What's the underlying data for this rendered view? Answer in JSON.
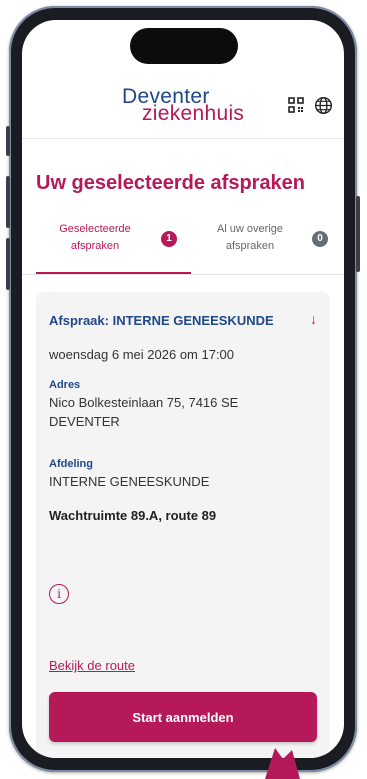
{
  "header": {
    "logo_line1": "Deventer",
    "logo_line2": "ziekenhuis",
    "qr_icon": "qr-code-icon",
    "language_icon": "globe-icon"
  },
  "page": {
    "title": "Uw geselecteerde afspraken"
  },
  "tabs": [
    {
      "label": "Geselecteerde afspraken",
      "badge": "1",
      "active": true
    },
    {
      "label": "Al uw overige afspraken",
      "badge": "0",
      "active": false
    }
  ],
  "appointment": {
    "title": "Afspraak: INTERNE GENEESKUNDE",
    "toggle_icon": "arrow-down-icon",
    "toggle_glyph": "↓",
    "datetime": "woensdag 6 mei 2026 om 17:00",
    "address_label": "Adres",
    "address_line1": "Nico Bolkesteinlaan 75, 7416 SE",
    "address_line2": "DEVENTER",
    "department_label": "Afdeling",
    "department": "INTERNE GENEESKUNDE",
    "waiting_room": "Wachtruimte 89.A, route 89",
    "info_icon": "info-icon",
    "info_glyph": "i",
    "route_link": "Bekijk de route",
    "start_button": "Start aanmelden"
  },
  "colors": {
    "accent": "#b5195a",
    "brand_blue": "#20478a",
    "badge_grey": "#676c75",
    "card_bg": "#f4f4f4"
  }
}
